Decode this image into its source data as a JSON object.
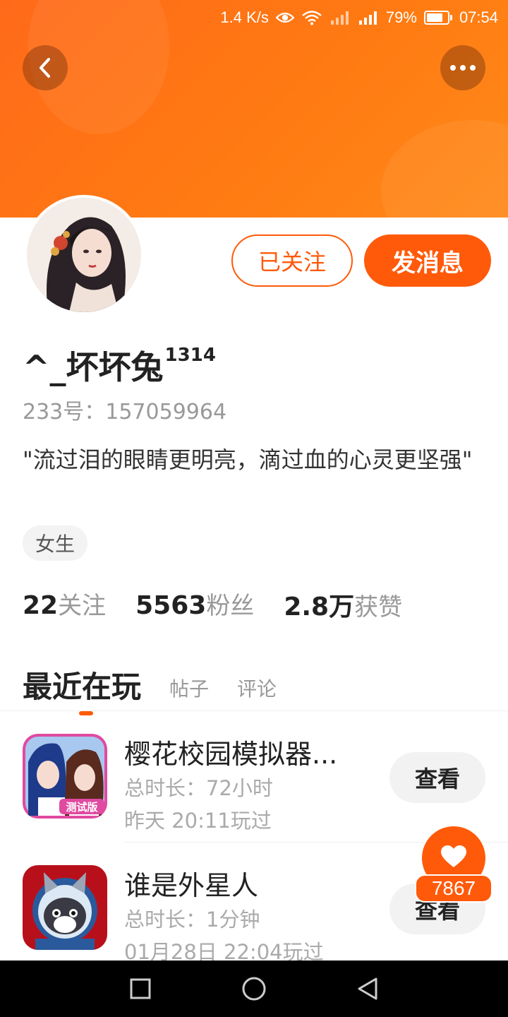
{
  "status_bar": {
    "speed": "1.4 K/s",
    "battery": "79%",
    "battery_level": 0.79,
    "time": "07:54"
  },
  "profile": {
    "username": "^_坏坏兔",
    "username_sup": "1314",
    "user_id": "233号：157059964",
    "bio": "\"流过泪的眼睛更明亮，滴过血的心灵更坚强\"",
    "gender": "女生",
    "follow_status_label": "已关注",
    "message_label": "发消息"
  },
  "stats": [
    {
      "num": "22",
      "label": "关注"
    },
    {
      "num": "5563",
      "label": "粉丝"
    },
    {
      "num": "2.8万",
      "label": "获赞"
    }
  ],
  "tabs": [
    {
      "label": "最近在玩",
      "active": true
    },
    {
      "label": "帖子",
      "active": false
    },
    {
      "label": "评论",
      "active": false
    }
  ],
  "games": [
    {
      "title": "樱花校园模拟器...",
      "duration": "总时长：72小时",
      "last_played": "昨天 20:11玩过",
      "icon_badge": "测试版",
      "action": "查看"
    },
    {
      "title": "谁是外星人",
      "duration": "总时长：1分钟",
      "last_played": "01月28日 22:04玩过",
      "action": "查看"
    }
  ],
  "like": {
    "count": "7867"
  },
  "colors": {
    "accent": "#ff5a0a",
    "header": "#ff7a12"
  }
}
